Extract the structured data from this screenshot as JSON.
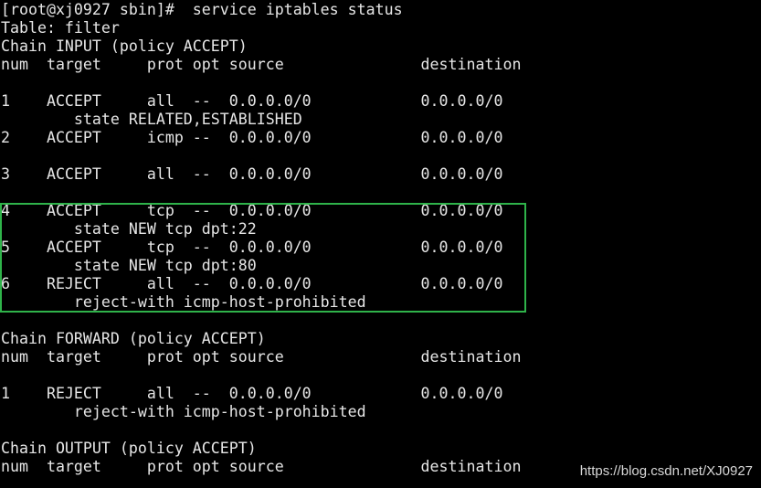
{
  "terminal": {
    "lines": [
      "[root@xj0927 sbin]#  service iptables status",
      "Table: filter",
      "Chain INPUT (policy ACCEPT)",
      "num  target     prot opt source               destination",
      "",
      "1    ACCEPT     all  --  0.0.0.0/0            0.0.0.0/0",
      "        state RELATED,ESTABLISHED",
      "2    ACCEPT     icmp --  0.0.0.0/0            0.0.0.0/0",
      "",
      "3    ACCEPT     all  --  0.0.0.0/0            0.0.0.0/0",
      "",
      "4    ACCEPT     tcp  --  0.0.0.0/0            0.0.0.0/0",
      "        state NEW tcp dpt:22",
      "5    ACCEPT     tcp  --  0.0.0.0/0            0.0.0.0/0",
      "        state NEW tcp dpt:80",
      "6    REJECT     all  --  0.0.0.0/0            0.0.0.0/0",
      "        reject-with icmp-host-prohibited",
      "",
      "Chain FORWARD (policy ACCEPT)",
      "num  target     prot opt source               destination",
      "",
      "1    REJECT     all  --  0.0.0.0/0            0.0.0.0/0",
      "        reject-with icmp-host-prohibited",
      "",
      "Chain OUTPUT (policy ACCEPT)",
      "num  target     prot opt source               destination"
    ]
  },
  "watermark": "https://blog.csdn.net/XJ0927",
  "colors": {
    "background": "#000000",
    "text": "#e6e6e6",
    "highlight_border": "#2fb34a"
  }
}
